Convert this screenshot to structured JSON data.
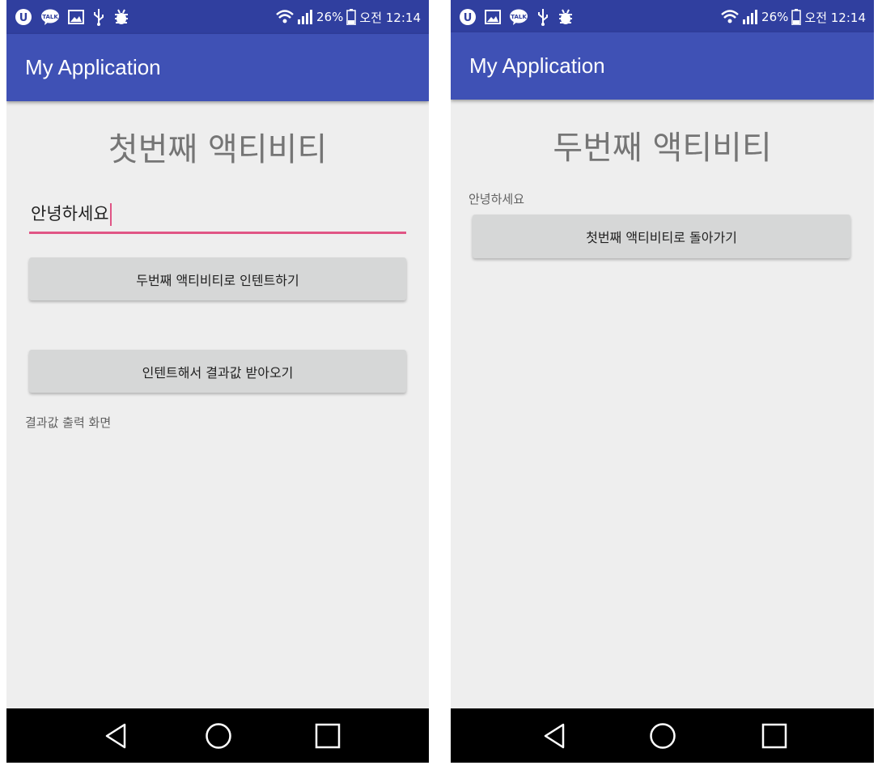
{
  "left": {
    "status": {
      "battery_percent": "26%",
      "time": "오전 12:14"
    },
    "app_title": "My Application",
    "heading": "첫번째 액티비티",
    "input_value": "안녕하세요",
    "btn_intent": "두번째 액티비티로 인텐트하기",
    "btn_result": "인텐트해서 결과값 받아오기",
    "result_text": "결과값 출력 화면"
  },
  "right": {
    "status": {
      "battery_percent": "26%",
      "time": "오전 12:14"
    },
    "app_title": "My Application",
    "heading": "두번째 액티비티",
    "received_text": "안녕하세요",
    "btn_back": "첫번째 액티비티로 돌아가기"
  },
  "icons": {
    "status_left": [
      "app-notification-icon",
      "kakaotalk-icon",
      "gallery-icon",
      "usb-icon",
      "debug-icon"
    ],
    "status_right": [
      "wifi-icon",
      "signal-icon",
      "battery-icon"
    ],
    "nav": [
      "back-icon",
      "home-icon",
      "recents-icon"
    ]
  },
  "colors": {
    "status_bar": "#303f9f",
    "app_bar": "#3f51b5",
    "accent": "#e05585",
    "background": "#eeeeee",
    "button": "#d6d7d7"
  }
}
